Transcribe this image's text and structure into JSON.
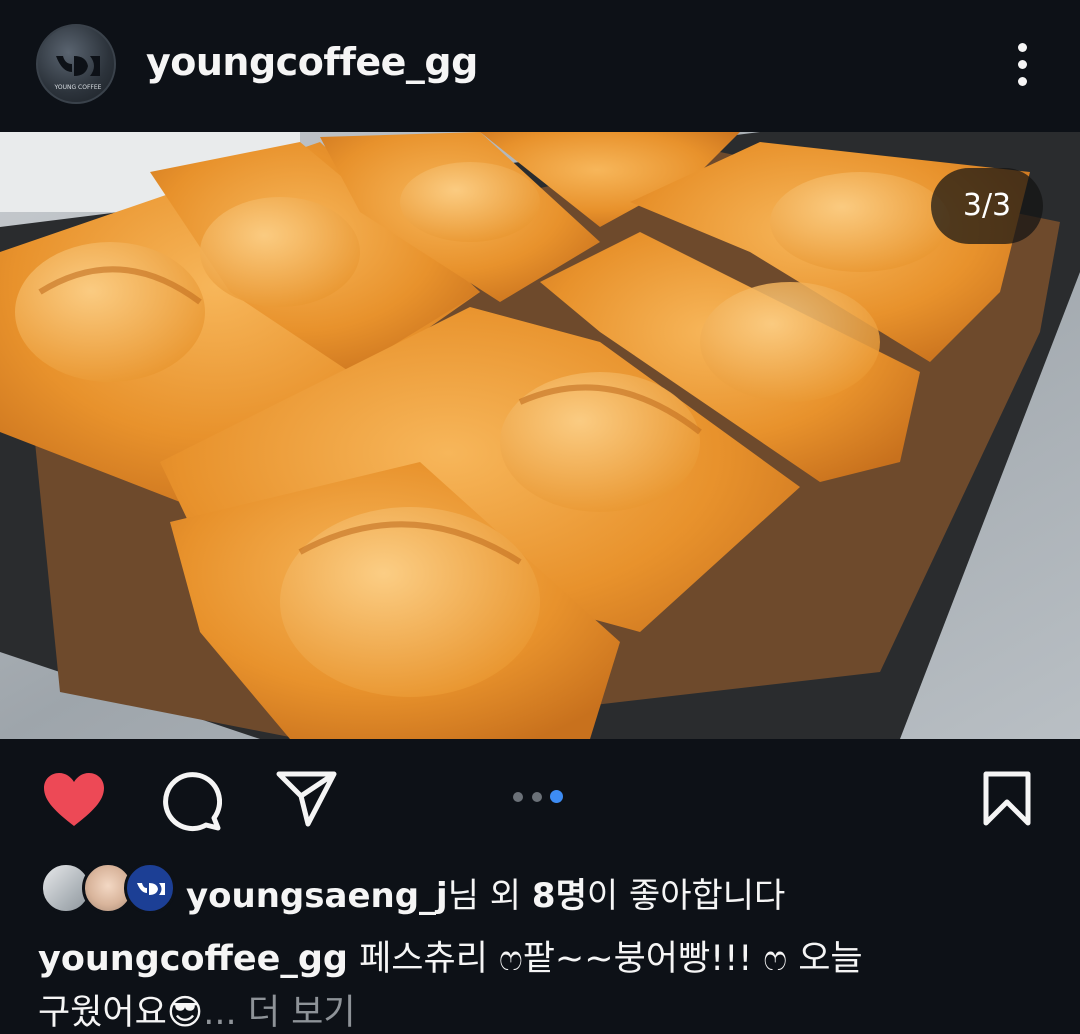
{
  "post": {
    "username": "youngcoffee_gg",
    "avatar_text": "YOUNG COFFEE",
    "image_counter": "3/3",
    "slide_total": 3,
    "slide_current": 3
  },
  "likes": {
    "user": "youngsaeng_j",
    "suffix_1": "님 외 ",
    "count": "8명",
    "suffix_2": "이 좋아합니다"
  },
  "caption": {
    "username": "youngcoffee_gg",
    "line1": " 페스츄리 ෆ팥~~붕어빵!!! ෆ 오늘",
    "line2": "구웠어요😎",
    "ellipsis": "... ",
    "more_label": "더 보기"
  },
  "icons": {
    "like": "heart-icon",
    "comment": "comment-icon",
    "share": "send-icon",
    "save": "bookmark-icon",
    "more": "more-vertical-icon"
  },
  "colors": {
    "background": "#0d1117",
    "like": "#ed4956",
    "active_dot": "#3d8cf4"
  }
}
